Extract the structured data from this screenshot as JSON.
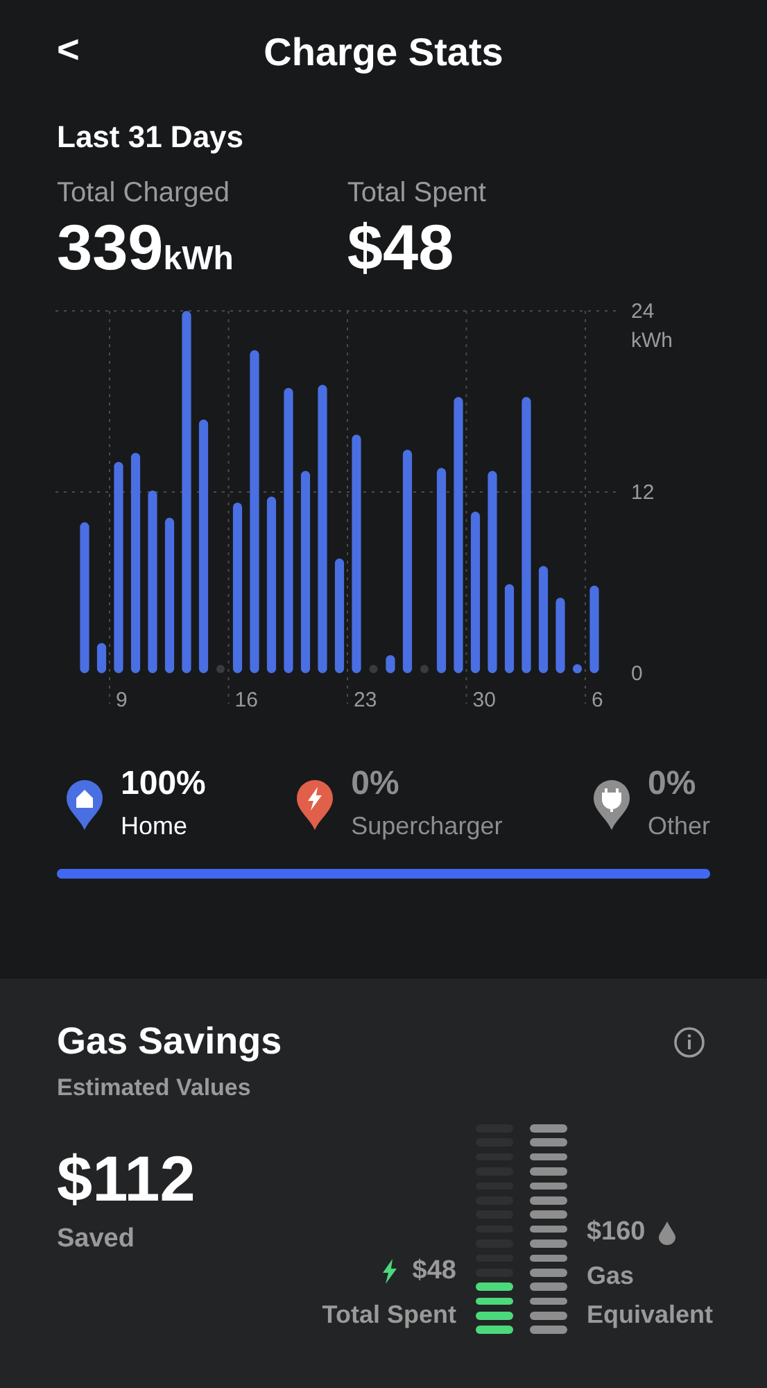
{
  "header": {
    "back": "<",
    "title": "Charge Stats"
  },
  "period": "Last 31 Days",
  "totals": [
    {
      "label": "Total Charged",
      "value": "339",
      "unit": "kWh"
    },
    {
      "label": "Total Spent",
      "value": "$48"
    }
  ],
  "chart_data": {
    "type": "bar",
    "ylabel": "kWh",
    "ylim": [
      0,
      24
    ],
    "yticks": [
      0,
      12,
      24
    ],
    "grid": true,
    "categories": [
      null,
      null,
      "9",
      null,
      null,
      null,
      null,
      null,
      null,
      "16",
      null,
      null,
      null,
      null,
      null,
      null,
      "23",
      null,
      null,
      null,
      null,
      null,
      null,
      "30",
      null,
      null,
      null,
      null,
      null,
      null,
      "6"
    ],
    "values": [
      10,
      2,
      14,
      14.6,
      12.1,
      10.3,
      24,
      16.8,
      0,
      11.3,
      21.4,
      11.7,
      18.9,
      13.4,
      19.1,
      7.6,
      15.8,
      0,
      1.2,
      14.8,
      0,
      13.6,
      18.3,
      10.7,
      13.4,
      5.9,
      18.3,
      7.1,
      5,
      0.6,
      5.8
    ]
  },
  "sources": [
    {
      "kind": "home",
      "percent": "100%",
      "label": "Home",
      "selected": true,
      "color": "#4a6fe3"
    },
    {
      "kind": "supercharger",
      "percent": "0%",
      "label": "Supercharger",
      "selected": false,
      "color": "#e0604a"
    },
    {
      "kind": "other",
      "percent": "0%",
      "label": "Other",
      "selected": false,
      "color": "#8e8e8e"
    }
  ],
  "share_bar": {
    "level": 1
  },
  "gas_savings": {
    "title": "Gas Savings",
    "subtitle": "Estimated Values",
    "amount": "$112",
    "amount_label": "Saved",
    "spent_value": "$48",
    "spent_label": "Total Spent",
    "spent_meter": {
      "level": 0.27
    },
    "gas_value": "$160",
    "gas_label_1": "Gas",
    "gas_label_2": "Equivalent"
  }
}
